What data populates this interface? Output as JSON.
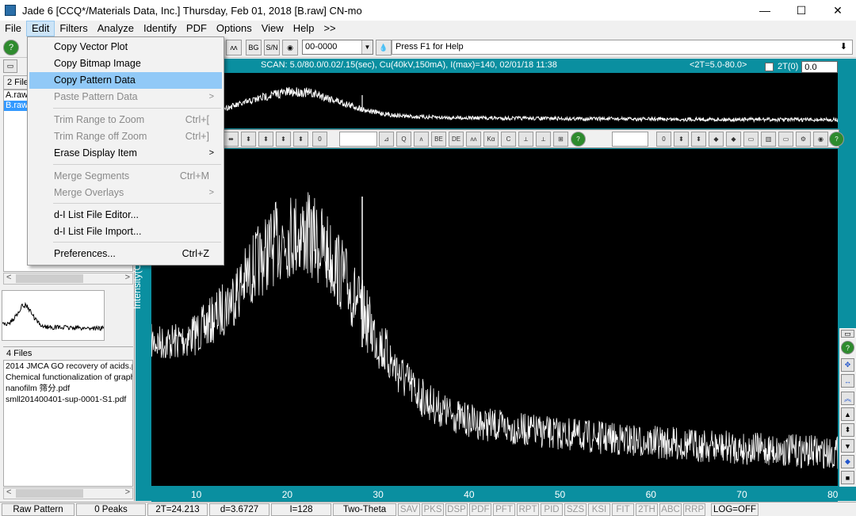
{
  "window": {
    "title": "Jade 6 [CCQ*/Materials Data, Inc.] Thursday, Feb 01, 2018 [B.raw] CN-mo",
    "minimize": "—",
    "maximize": "☐",
    "close": "✕"
  },
  "menubar": [
    "File",
    "Edit",
    "Filters",
    "Analyze",
    "Identify",
    "PDF",
    "Options",
    "View",
    "Help",
    ">>"
  ],
  "toolbar": {
    "pdf_combo": "00-0000",
    "help_text": "Press F1 for Help",
    "help_arrow": "⬇"
  },
  "left_panel": {
    "files_header": "2 Files",
    "raw_files": [
      "A.raw",
      "B.raw"
    ],
    "doc_header": "4 Files",
    "documents": [
      "2014 JMCA GO recovery of acids.p",
      "Chemical functionalization of graph",
      "nanofilm 筛分.pdf",
      "smll201400401-sup-0001-S1.pdf"
    ]
  },
  "scan_info": {
    "scan": "SCAN: 5.0/80.0/0.02/.15(sec), Cu(40kV,150mA), I(max)=140, 02/01/18 11:38",
    "range": "<2T=5.0-80.0>",
    "twotheta_label": "2T(0)",
    "twotheta_value": "0.0"
  },
  "edit_menu": [
    {
      "label": "Copy Vector Plot",
      "shortcut": "",
      "enabled": true
    },
    {
      "label": "Copy Bitmap Image",
      "shortcut": "",
      "enabled": true
    },
    {
      "label": "Copy Pattern Data",
      "shortcut": "",
      "enabled": true,
      "highlighted": true
    },
    {
      "label": "Paste Pattern Data",
      "shortcut": ">",
      "enabled": false
    },
    {
      "label": "Trim Range to Zoom",
      "shortcut": "Ctrl+[",
      "enabled": false
    },
    {
      "label": "Trim Range off Zoom",
      "shortcut": "Ctrl+]",
      "enabled": false
    },
    {
      "label": "Erase Display Item",
      "shortcut": ">",
      "enabled": true
    },
    {
      "label": "Merge Segments",
      "shortcut": "Ctrl+M",
      "enabled": false
    },
    {
      "label": "Merge Overlays",
      "shortcut": ">",
      "enabled": false
    },
    {
      "label": "d-I List File Editor...",
      "shortcut": "",
      "enabled": true
    },
    {
      "label": "d-I List File Import...",
      "shortcut": "",
      "enabled": true
    },
    {
      "label": "Preferences...",
      "shortcut": "Ctrl+Z",
      "enabled": true
    }
  ],
  "plot": {
    "ylabel": "Intensity(Counts)",
    "xticks": [
      "10",
      "20",
      "30",
      "40",
      "50",
      "60",
      "70",
      "80"
    ]
  },
  "status_bar": {
    "mode": "Raw Pattern",
    "peaks": "0 Peaks",
    "two_theta": "2T=24.213",
    "d": "d=3.6727",
    "intensity": "I=128",
    "scan_type": "Two-Theta",
    "buttons": [
      "SAV",
      "PKS",
      "DSP",
      "PDF",
      "PFT",
      "RPT",
      "PID",
      "SZS",
      "KSI",
      "FIT",
      "2TH",
      "ABC",
      "RRP"
    ],
    "log": "LOG=OFF"
  },
  "colors": {
    "plot_background": "#000000",
    "trace": "#ffffff",
    "panel_teal": "#0a8fa0",
    "menu_highlight": "#91c9f7",
    "selection": "#3399ff"
  }
}
